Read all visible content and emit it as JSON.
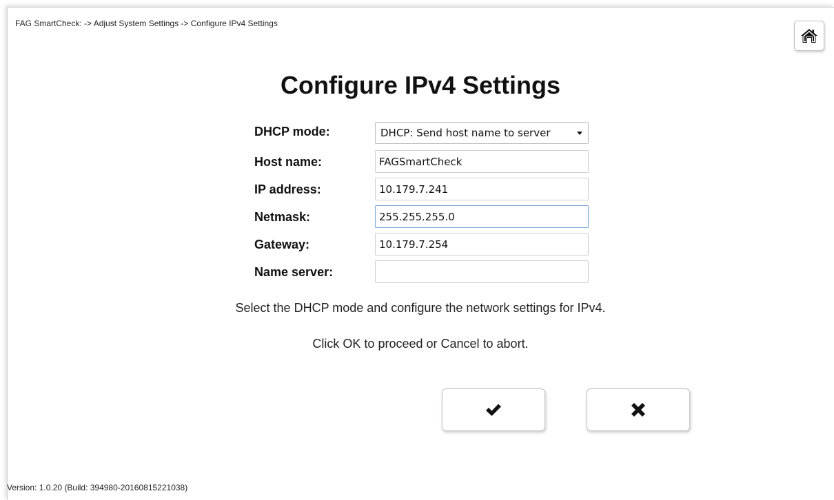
{
  "breadcrumb": "FAG SmartCheck: -> Adjust System Settings -> Configure IPv4 Settings",
  "home_icon": "home-icon",
  "title": "Configure IPv4 Settings",
  "form": {
    "dhcp_mode": {
      "label": "DHCP mode:",
      "value": "DHCP: Send host name to server"
    },
    "host_name": {
      "label": "Host name:",
      "value": "FAGSmartCheck"
    },
    "ip_address": {
      "label": "IP address:",
      "value": "10.179.7.241"
    },
    "netmask": {
      "label": "Netmask:",
      "value": "255.255.255.0"
    },
    "gateway": {
      "label": "Gateway:",
      "value": "10.179.7.254"
    },
    "name_server": {
      "label": "Name server:",
      "value": ""
    }
  },
  "instructions": {
    "line1": "Select the DHCP mode and configure the network settings for IPv4.",
    "line2": "Click OK to proceed or Cancel to abort."
  },
  "buttons": {
    "ok_icon": "checkmark-icon",
    "cancel_icon": "x-icon"
  },
  "version": "Version: 1.0.20 (Build: 394980-20160815221038)"
}
